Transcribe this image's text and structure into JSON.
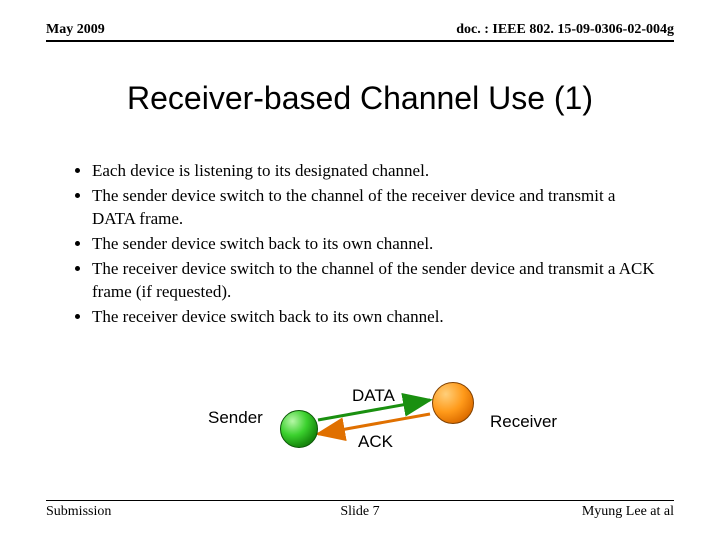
{
  "header": {
    "date": "May 2009",
    "doc_ref": "doc. : IEEE 802. 15-09-0306-02-004g"
  },
  "title": "Receiver-based Channel Use (1)",
  "bullets": [
    "Each device is listening to its designated channel.",
    "The sender device switch to the channel of the receiver device and transmit a DATA frame.",
    "The sender device switch back to its own channel.",
    "The receiver device switch to the channel of the sender device and transmit a ACK frame (if requested).",
    "The receiver device switch back to its own channel."
  ],
  "diagram": {
    "sender": "Sender",
    "receiver": "Receiver",
    "data": "DATA",
    "ack": "ACK"
  },
  "footer": {
    "left": "Submission",
    "center": "Slide 7",
    "right": "Myung Lee at al"
  }
}
